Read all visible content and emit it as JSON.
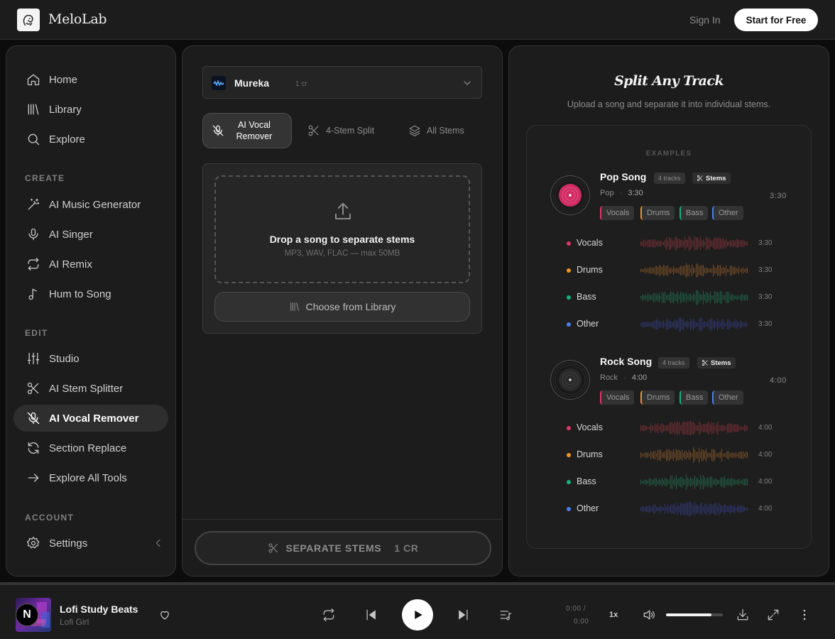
{
  "header": {
    "app_name": "MeloLab",
    "sign_in": "Sign In",
    "start_free": "Start for Free"
  },
  "sidebar": {
    "items": [
      {
        "label": "Home",
        "icon": "home-icon"
      },
      {
        "label": "Library",
        "icon": "library-icon"
      },
      {
        "label": "Explore",
        "icon": "search-icon"
      }
    ],
    "create_label": "CREATE",
    "create_items": [
      {
        "label": "AI Music Generator",
        "icon": "magic-wand-icon"
      },
      {
        "label": "AI Singer",
        "icon": "microphone-icon"
      },
      {
        "label": "AI Remix",
        "icon": "repeat-icon"
      },
      {
        "label": "Hum to Song",
        "icon": "music-note-icon"
      }
    ],
    "edit_label": "EDIT",
    "edit_items": [
      {
        "label": "Studio",
        "icon": "sliders-icon"
      },
      {
        "label": "AI Stem Splitter",
        "icon": "scissors-icon"
      },
      {
        "label": "AI Vocal Remover",
        "icon": "mic-off-icon",
        "active": true
      },
      {
        "label": "Section Replace",
        "icon": "refresh-icon"
      },
      {
        "label": "Explore All Tools",
        "icon": "arrow-right-icon"
      }
    ],
    "account_label": "ACCOUNT",
    "account_items": [
      {
        "label": "Settings",
        "icon": "gear-icon"
      }
    ]
  },
  "tool": {
    "model_name": "Mureka",
    "model_cost": "1 cr",
    "tabs": [
      {
        "label": "AI Vocal Remover",
        "line1": "AI Vocal",
        "line2": "Remover",
        "active": true
      },
      {
        "label": "4-Stem Split"
      },
      {
        "label": "All Stems"
      }
    ],
    "drop_title": "Drop a song to separate stems",
    "drop_sub": "MP3, WAV, FLAC — max 50MB",
    "library_btn": "Choose from Library",
    "separate_btn": "SEPARATE STEMS",
    "separate_cost": "1 CR"
  },
  "examples": {
    "title": "Split Any Track",
    "subtitle": "Upload a song and separate it into individual stems.",
    "label": "EXAMPLES",
    "songs": [
      {
        "title": "Pop Song",
        "tracks": "4 tracks",
        "stems_badge": "Stems",
        "genre": "Pop",
        "sep": "·",
        "length": "3:30",
        "duration": "3:30",
        "chips": [
          "Vocals",
          "Drums",
          "Bass",
          "Other"
        ],
        "stems": [
          {
            "name": "Vocals",
            "time": "3:30"
          },
          {
            "name": "Drums",
            "time": "3:30"
          },
          {
            "name": "Bass",
            "time": "3:30"
          },
          {
            "name": "Other",
            "time": "3:30"
          }
        ]
      },
      {
        "title": "Rock Song",
        "tracks": "4 tracks",
        "stems_badge": "Stems",
        "genre": "Rock",
        "sep": "·",
        "length": "4:00",
        "duration": "4:00",
        "chips": [
          "Vocals",
          "Drums",
          "Bass",
          "Other"
        ],
        "stems": [
          {
            "name": "Vocals",
            "time": "4:00"
          },
          {
            "name": "Drums",
            "time": "4:00"
          },
          {
            "name": "Bass",
            "time": "4:00"
          },
          {
            "name": "Other",
            "time": "4:00"
          }
        ]
      }
    ],
    "stem_colors": {
      "Vocals": "#e0366a",
      "Drums": "#e8962f",
      "Bass": "#19b081",
      "Other": "#4b7fe6"
    },
    "wave_colors": {
      "Vocals": "#6e2d34",
      "Drums": "#704a26",
      "Bass": "#1f5a43",
      "Other": "#2f356b"
    }
  },
  "player": {
    "title": "Lofi Study Beats",
    "artist": "Lofi Girl",
    "cover_letter": "N",
    "time_current": "0:00 /",
    "time_total": "0:00",
    "speed": "1x",
    "volume": 0.8
  }
}
